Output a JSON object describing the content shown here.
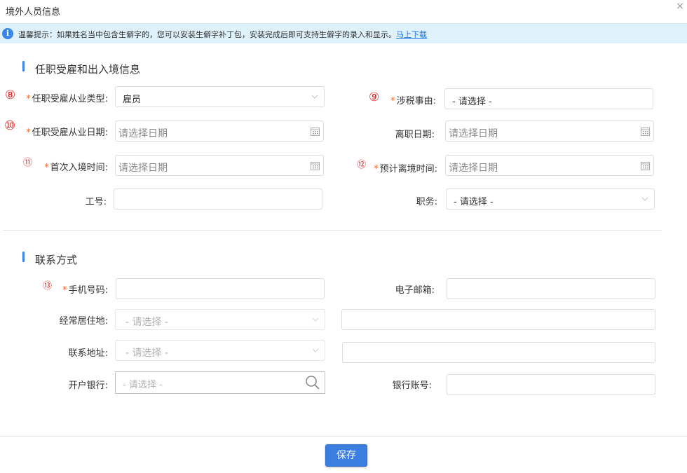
{
  "window": {
    "title": "境外人员信息",
    "close_glyph": "×"
  },
  "tip": {
    "icon": "i",
    "text": "温馨提示：如果姓名当中包含生僻字的，您可以安装生僻字补丁包，安装完成后即可支持生僻字的录入和显示。",
    "link": "马上下载"
  },
  "section1": {
    "title": "任职受雇和出入境信息"
  },
  "section2": {
    "title": "联系方式"
  },
  "annotations": {
    "m8": "⑧",
    "m9": "⑨",
    "m10": "⑩",
    "m11": "⑪",
    "m12": "⑫",
    "m13": "⑬"
  },
  "required_mark": "*",
  "fields": {
    "employment_type": {
      "label": "任职受雇从业类型:",
      "value": "雇员"
    },
    "tax_matter": {
      "label": "涉税事由:",
      "placeholder": "- 请选择 -"
    },
    "employment_date": {
      "label": "任职受雇从业日期:",
      "placeholder": "请选择日期"
    },
    "leave_date": {
      "label": "离职日期:",
      "placeholder": "请选择日期"
    },
    "first_entry_time": {
      "label": "首次入境时间:",
      "placeholder": "请选择日期"
    },
    "expected_departure_time": {
      "label": "预计离境时间:",
      "placeholder": "请选择日期"
    },
    "employee_id": {
      "label": "工号:",
      "value": ""
    },
    "position": {
      "label": "职务:",
      "placeholder": "- 请选择 -"
    },
    "mobile": {
      "label": "手机号码:",
      "value": ""
    },
    "email": {
      "label": "电子邮箱:",
      "value": ""
    },
    "residence": {
      "label": "经常居住地:",
      "placeholder": "- 请选择 -",
      "detail": ""
    },
    "contact_address": {
      "label": "联系地址:",
      "placeholder": "- 请选择 -",
      "detail": ""
    },
    "bank": {
      "label": "开户银行:",
      "placeholder": "- 请选择 -"
    },
    "bank_account": {
      "label": "银行账号:",
      "value": ""
    }
  },
  "buttons": {
    "save": "保存"
  },
  "colors": {
    "accent": "#3a86e6",
    "required": "#f06a2f",
    "annotation": "#e02020",
    "tip_bg": "#dff2fb"
  }
}
